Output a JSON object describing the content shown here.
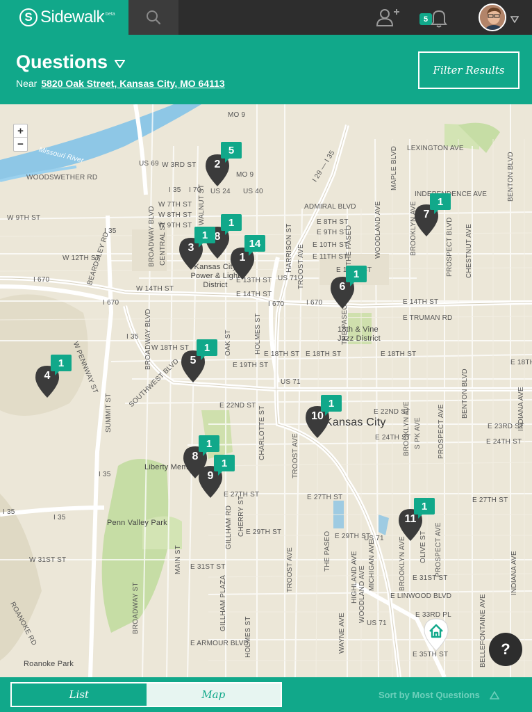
{
  "app": {
    "name": "Sidewalk",
    "beta": "beta",
    "notification_count": "5",
    "brand_color": "#11a88a"
  },
  "header": {
    "title": "Questions",
    "near_label": "Near",
    "address": "5820 Oak Street, Kansas City, MO 64113",
    "filter_button": "Filter Results"
  },
  "map": {
    "zoom_in": "+",
    "zoom_out": "−",
    "labels": {
      "missouri_river": "Missouri River",
      "us69": "US 69",
      "w3rd": "W 3RD ST",
      "woodswether": "WOODSWETHER RD",
      "i35a": "I 35",
      "i70": "I 70",
      "us24": "US 24",
      "us40": "US 40",
      "mo9a": "MO 9",
      "mo9b": "MO 9",
      "lexington": "LEXINGTON AVE",
      "maple": "MAPLE BLVD",
      "benton_n": "BENTON BLVD",
      "independence": "INDEPENDENCE AVE",
      "admiral": "ADMIRAL BLVD",
      "w7th": "W 7TH ST",
      "w8th": "W 8TH ST",
      "w9th_a": "W 9TH ST",
      "w9th_b": "W 9TH ST",
      "e8th": "E 8TH ST",
      "e9th": "E 9TH ST",
      "e10th": "E 10TH ST",
      "e11th": "E 11TH ST",
      "e12th": "E 12TH ST",
      "e13th": "E 13TH ST",
      "e14th_a": "E 14TH ST",
      "e14th_b": "E 14TH ST",
      "w12th": "W 12TH ST",
      "w14th": "W 14TH ST",
      "i670a": "I 670",
      "i670b": "I 670",
      "i670c": "I 670",
      "i670d": "I 670",
      "us71a": "US 71",
      "us71b": "US 71",
      "us71c": "US 71",
      "us71d": "US 71",
      "i35b": "I 35",
      "i35c": "I 35",
      "i35d": "I 35",
      "i35e": "I 35",
      "i35f": "I 35",
      "i29": "I 29 — I 35",
      "power_light": "Kansas City Power & Light District",
      "e_truman": "E TRUMAN RD",
      "w18th": "W 18TH ST",
      "e18th_a": "E 18TH ST",
      "e18th_b": "E 18TH ST",
      "e18th_c": "E 18TH ST",
      "e19th": "E 19TH ST",
      "vine": "18th & Vine Jazz District",
      "e22nd": "E 22ND ST",
      "e22nd_b": "E 22ND ST",
      "e23rd": "E 23RD ST",
      "e24th_a": "E 24TH ST",
      "e24th_b": "E 24TH ST",
      "kc": "Kansas City",
      "liberty": "Liberty Mem",
      "penn_valley": "Penn Valley Park",
      "e27th_a": "E 27TH ST",
      "e27th_b": "E 27TH ST",
      "e27th_c": "E 27TH ST",
      "e29th_a": "E 29TH ST",
      "e29th_b": "E 29TH ST",
      "w31st": "W 31ST ST",
      "e31st_a": "E 31ST ST",
      "e31st_b": "E 31ST ST",
      "linwood": "E LINWOOD BLVD",
      "e33rd": "E 33RD PL",
      "e35th": "E 35TH ST",
      "armour": "E ARMOUR BLVD",
      "roanoke_park": "Roanoke Park",
      "roanoke_rd": "ROANOKE RD",
      "broadway_a": "BROADWAY BLVD",
      "broadway_b": "BROADWAY BLVD",
      "broadway_c": "BROADWAY ST",
      "central": "CENTRAL ST",
      "walnut": "WALNUT ST",
      "main": "MAIN ST",
      "oak": "OAK ST",
      "holmes_a": "HOLMES ST",
      "holmes_b": "HOLMES ST",
      "charlotte": "CHARLOTTE ST",
      "cherry": "CHERRY ST",
      "gillham_rd": "GILLHAM RD",
      "gillham_plaza": "GILLHAM PLAZA",
      "troost_a": "TROOST AVE",
      "troost_b": "TROOST AVE",
      "troost_c": "TROOST AVE",
      "harrison": "HARRISON ST",
      "paseo_a": "THE PASEO",
      "paseo_b": "THE PASEO",
      "paseo_c": "THE PASEO",
      "woodland_a": "WOODLAND AVE",
      "woodland_b": "WOODLAND AVE",
      "highland": "HIGHLAND AVE",
      "michigan": "MICHIGAN AVE",
      "wayne": "WAYNE AVE",
      "brooklyn_a": "BROOKLYN AVE",
      "brooklyn_b": "BROOKLYN AVE",
      "brooklyn_c": "BROOKLYN AVE",
      "prospect_a": "PROSPECT BLVD",
      "prospect_b": "PROSPECT AVE",
      "prospect_c": "PROSPECT AVE",
      "chestnut": "CHESTNUT AVE",
      "benton_s": "BENTON BLVD",
      "indiana_a": "INDIANA AVE",
      "indiana_b": "INDIANA AVE",
      "bellefontaine": "BELLEFONTAINE AVE",
      "olive": "OLIVE ST",
      "spk": "S PK AVE",
      "summit": "SUMMIT ST",
      "beardsley": "BEARDSLEY RD",
      "southwest": "SOUTHWEST BLVD",
      "wpennway": "W PENNWAY ST",
      "e18th_d": "E 18TH"
    },
    "pins": [
      {
        "id": "2",
        "count": "5"
      },
      {
        "id": "7",
        "count": "1"
      },
      {
        "id": "3",
        "count": "1"
      },
      {
        "id": "1",
        "count": "14"
      },
      {
        "id": "8",
        "count": "1"
      },
      {
        "id": "6",
        "count": "1"
      },
      {
        "id": "5",
        "count": "1"
      },
      {
        "id": "4",
        "count": "1"
      },
      {
        "id": "10",
        "count": "1"
      },
      {
        "id": "8",
        "count": "1"
      },
      {
        "id": "9",
        "count": "1"
      },
      {
        "id": "11",
        "count": "1"
      }
    ],
    "help": "?"
  },
  "footer": {
    "list_tab": "List",
    "map_tab": "Map",
    "sort_label": "Sort by Most Questions"
  }
}
